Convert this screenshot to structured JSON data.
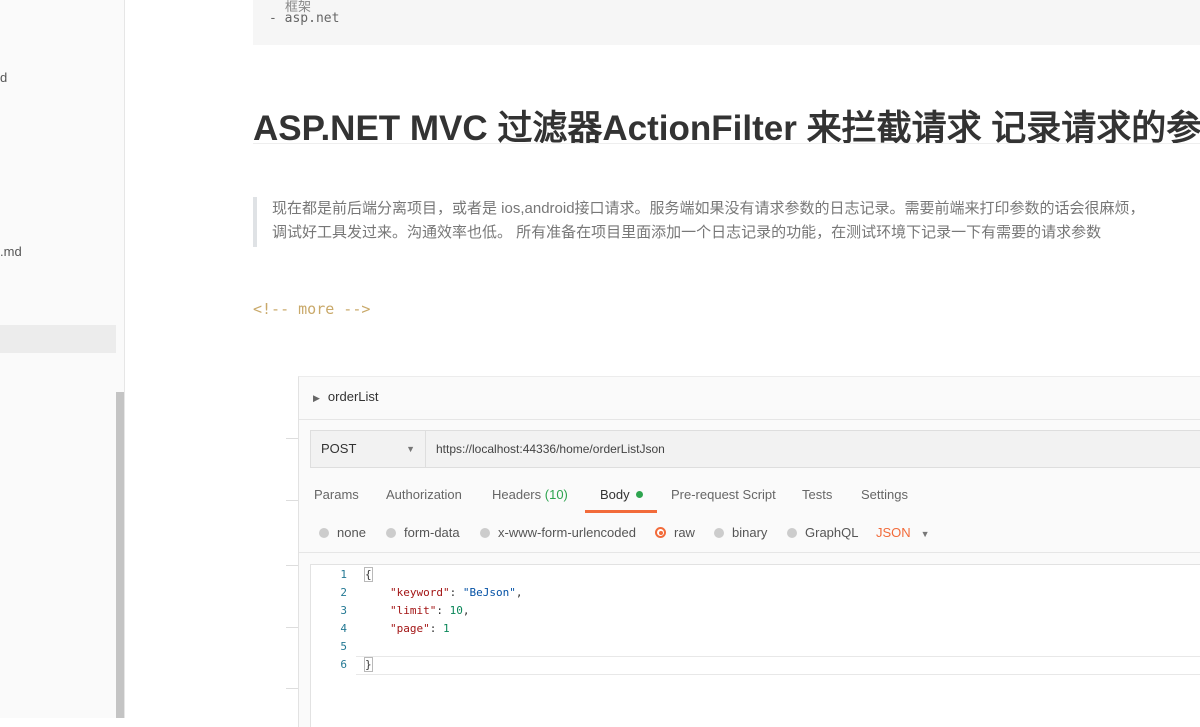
{
  "sidebar": {
    "items": [
      {
        "label": "d"
      },
      {
        "label": ".md"
      }
    ]
  },
  "content": {
    "code_lines": [
      "框架",
      "- asp.net"
    ],
    "heading": "ASP.NET MVC 过滤器ActionFilter 来拦截请求 记录请求的参数",
    "quote_lines": [
      "现在都是前后端分离项目，或者是 ios,android接口请求。服务端如果没有请求参数的日志记录。需要前端来打印参数的话会很麻烦，",
      "调试好工具发过来。沟通效率也低。 所有准备在项目里面添加一个日志记录的功能，在测试环境下记录一下有需要的请求参数"
    ],
    "more_comment": "<!-- more -->"
  },
  "postman": {
    "request_name": "orderList",
    "method": "POST",
    "url": "https://localhost:44336/home/orderListJson",
    "tabs": [
      {
        "label": "Params"
      },
      {
        "label": "Authorization"
      },
      {
        "label": "Headers",
        "count": "(10)"
      },
      {
        "label": "Body"
      },
      {
        "label": "Pre-request Script"
      },
      {
        "label": "Tests"
      },
      {
        "label": "Settings"
      }
    ],
    "active_tab": "Body",
    "body_types": [
      "none",
      "form-data",
      "x-www-form-urlencoded",
      "raw",
      "binary",
      "GraphQL"
    ],
    "selected_body_type": "raw",
    "format": "JSON",
    "editor": {
      "line_numbers": [
        "1",
        "2",
        "3",
        "4",
        "5",
        "6"
      ],
      "open_brace": "{",
      "close_brace": "}",
      "fields": [
        {
          "key": "\"keyword\"",
          "value": "\"BeJson\"",
          "sep": ",",
          "type": "string"
        },
        {
          "key": "\"limit\"",
          "value": "10",
          "sep": ",",
          "type": "number"
        },
        {
          "key": "\"page\"",
          "value": "1",
          "sep": "",
          "type": "number"
        }
      ]
    },
    "accent_color": "#f26b3a",
    "indicator_color": "#2ea44f"
  }
}
